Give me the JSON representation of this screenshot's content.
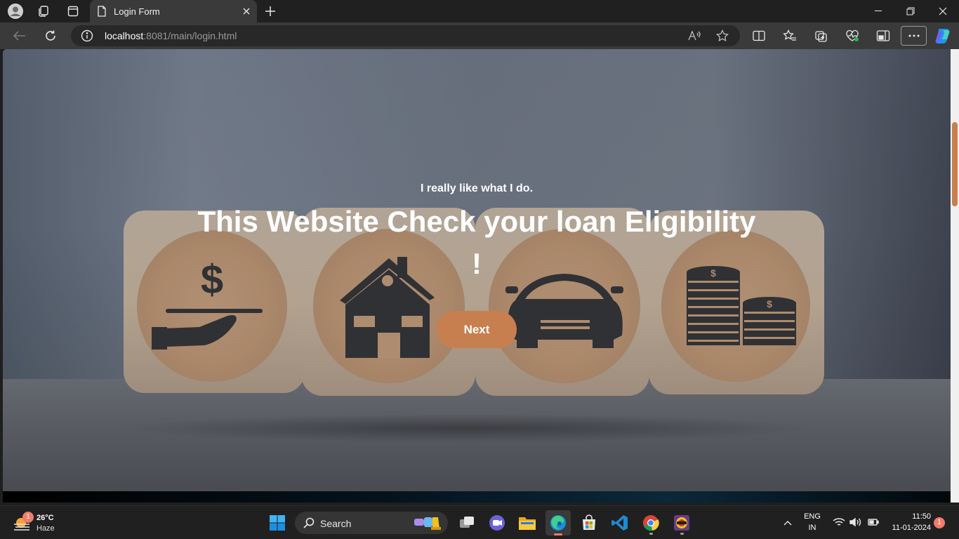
{
  "browser": {
    "tab_title": "Login Form",
    "url_host": "localhost",
    "url_rest": ":8081/main/login.html"
  },
  "page": {
    "subtitle": "I really like what I do.",
    "headline": "This Website Check your loan Eligibility !",
    "next_label": "Next"
  },
  "taskbar": {
    "weather_badge": "1",
    "temperature": "26°C",
    "condition": "Haze",
    "search_label": "Search",
    "language": "ENG",
    "region": "IN",
    "time": "11:50",
    "date": "11-01-2024",
    "notification_count": "1"
  },
  "colors": {
    "accent": "#c87f4f",
    "tab_bar": "#202020",
    "toolbar": "#3a3a3a"
  }
}
